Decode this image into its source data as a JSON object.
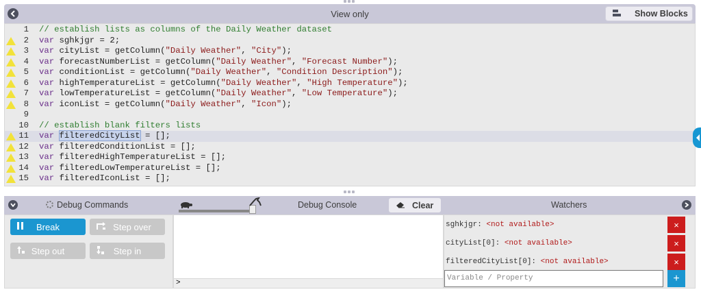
{
  "editor": {
    "title": "View only",
    "show_blocks_label": "Show Blocks",
    "lines": [
      {
        "n": "1",
        "warn": false,
        "active": false,
        "tokens": [
          {
            "t": "// establish lists as columns of the Daily Weather dataset",
            "c": "cmt"
          }
        ]
      },
      {
        "n": "2",
        "warn": true,
        "active": false,
        "tokens": [
          {
            "t": "var",
            "c": "kw"
          },
          {
            "t": " sghkjgr = 2;",
            "c": ""
          }
        ]
      },
      {
        "n": "3",
        "warn": true,
        "active": false,
        "tokens": [
          {
            "t": "var",
            "c": "kw"
          },
          {
            "t": " cityList = getColumn(",
            "c": ""
          },
          {
            "t": "\"Daily Weather\"",
            "c": "str"
          },
          {
            "t": ", ",
            "c": ""
          },
          {
            "t": "\"City\"",
            "c": "str"
          },
          {
            "t": ");",
            "c": ""
          }
        ]
      },
      {
        "n": "4",
        "warn": true,
        "active": false,
        "tokens": [
          {
            "t": "var",
            "c": "kw"
          },
          {
            "t": " forecastNumberList = getColumn(",
            "c": ""
          },
          {
            "t": "\"Daily Weather\"",
            "c": "str"
          },
          {
            "t": ", ",
            "c": ""
          },
          {
            "t": "\"Forecast Number\"",
            "c": "str"
          },
          {
            "t": ");",
            "c": ""
          }
        ]
      },
      {
        "n": "5",
        "warn": true,
        "active": false,
        "tokens": [
          {
            "t": "var",
            "c": "kw"
          },
          {
            "t": " conditionList = getColumn(",
            "c": ""
          },
          {
            "t": "\"Daily Weather\"",
            "c": "str"
          },
          {
            "t": ", ",
            "c": ""
          },
          {
            "t": "\"Condition Description\"",
            "c": "str"
          },
          {
            "t": ");",
            "c": ""
          }
        ]
      },
      {
        "n": "6",
        "warn": true,
        "active": false,
        "tokens": [
          {
            "t": "var",
            "c": "kw"
          },
          {
            "t": " highTemperatureList = getColumn(",
            "c": ""
          },
          {
            "t": "\"Daily Weather\"",
            "c": "str"
          },
          {
            "t": ", ",
            "c": ""
          },
          {
            "t": "\"High Temperature\"",
            "c": "str"
          },
          {
            "t": ");",
            "c": ""
          }
        ]
      },
      {
        "n": "7",
        "warn": true,
        "active": false,
        "tokens": [
          {
            "t": "var",
            "c": "kw"
          },
          {
            "t": " lowTemperatureList = getColumn(",
            "c": ""
          },
          {
            "t": "\"Daily Weather\"",
            "c": "str"
          },
          {
            "t": ", ",
            "c": ""
          },
          {
            "t": "\"Low Temperature\"",
            "c": "str"
          },
          {
            "t": ");",
            "c": ""
          }
        ]
      },
      {
        "n": "8",
        "warn": true,
        "active": false,
        "tokens": [
          {
            "t": "var",
            "c": "kw"
          },
          {
            "t": " iconList = getColumn(",
            "c": ""
          },
          {
            "t": "\"Daily Weather\"",
            "c": "str"
          },
          {
            "t": ", ",
            "c": ""
          },
          {
            "t": "\"Icon\"",
            "c": "str"
          },
          {
            "t": ");",
            "c": ""
          }
        ]
      },
      {
        "n": "9",
        "warn": false,
        "active": false,
        "tokens": []
      },
      {
        "n": "10",
        "warn": false,
        "active": false,
        "tokens": [
          {
            "t": "// establish blank filters lists",
            "c": "cmt"
          }
        ]
      },
      {
        "n": "11",
        "warn": true,
        "active": true,
        "tokens": [
          {
            "t": "var",
            "c": "kw"
          },
          {
            "t": " ",
            "c": ""
          },
          {
            "t": "filteredCityList",
            "c": "sel"
          },
          {
            "t": " = [];",
            "c": ""
          }
        ]
      },
      {
        "n": "12",
        "warn": true,
        "active": false,
        "tokens": [
          {
            "t": "var",
            "c": "kw"
          },
          {
            "t": " filteredConditionList = [];",
            "c": ""
          }
        ]
      },
      {
        "n": "13",
        "warn": true,
        "active": false,
        "tokens": [
          {
            "t": "var",
            "c": "kw"
          },
          {
            "t": " filteredHighTemperatureList = [];",
            "c": ""
          }
        ]
      },
      {
        "n": "14",
        "warn": true,
        "active": false,
        "tokens": [
          {
            "t": "var",
            "c": "kw"
          },
          {
            "t": " filteredLowTemperatureList = [];",
            "c": ""
          }
        ]
      },
      {
        "n": "15",
        "warn": true,
        "active": false,
        "tokens": [
          {
            "t": "var",
            "c": "kw"
          },
          {
            "t": " filteredIconList = [];",
            "c": ""
          }
        ]
      }
    ]
  },
  "debug": {
    "commands_title": "Debug Commands",
    "console_title": "Debug Console",
    "clear_label": "Clear",
    "watchers_title": "Watchers",
    "buttons": {
      "break": "Break",
      "step_over": "Step over",
      "step_out": "Step out",
      "step_in": "Step in"
    },
    "console_prompt": ">",
    "watchers": [
      {
        "name": "sghkjgr:",
        "value": "<not available>"
      },
      {
        "name": "cityList[0]:",
        "value": "<not available>"
      },
      {
        "name": "filteredCityList[0]:",
        "value": "<not available>"
      }
    ],
    "watch_placeholder": "Variable / Property"
  },
  "colors": {
    "accent": "#1b96d0",
    "header": "#c9c8d8",
    "danger": "#cc1d1d",
    "warning": "#f2e23a"
  }
}
